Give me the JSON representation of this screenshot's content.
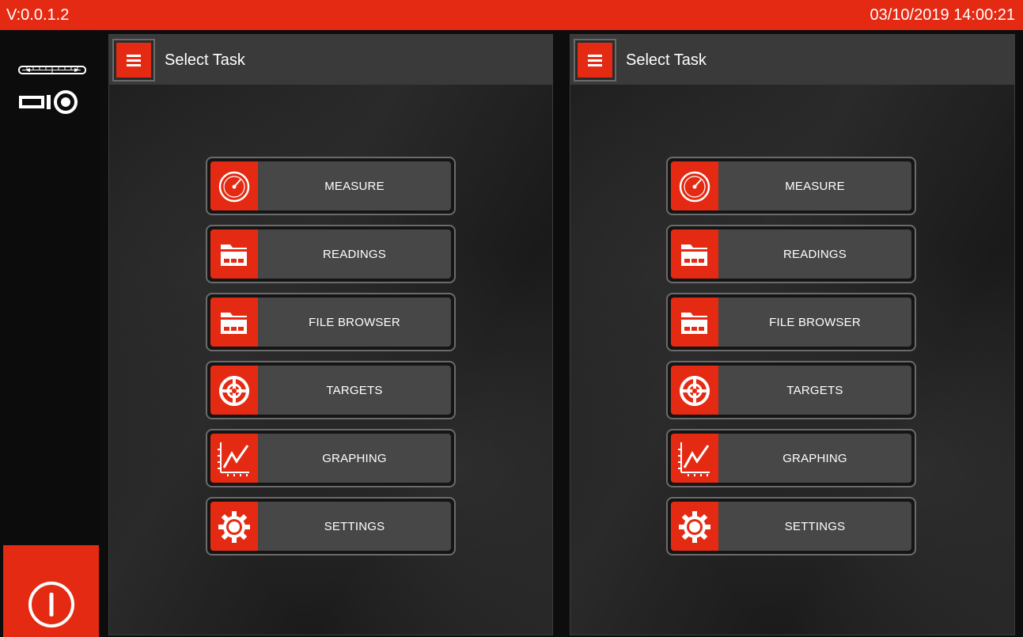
{
  "status_bar": {
    "version": "V:0.0.1.2",
    "datetime": "03/10/2019 14:00:21"
  },
  "colors": {
    "accent": "#e42a12",
    "button_face": "#474747",
    "header": "#3a3a3a"
  },
  "panels": [
    {
      "title": "Select Task",
      "menu_icon": "hamburger-menu-icon",
      "tasks": [
        {
          "label": "MEASURE",
          "icon": "gauge-icon"
        },
        {
          "label": "READINGS",
          "icon": "folder-icon"
        },
        {
          "label": "FILE BROWSER",
          "icon": "folder-icon"
        },
        {
          "label": "TARGETS",
          "icon": "target-icon"
        },
        {
          "label": "GRAPHING",
          "icon": "graph-icon"
        },
        {
          "label": "SETTINGS",
          "icon": "gear-icon"
        }
      ]
    },
    {
      "title": "Select Task",
      "menu_icon": "hamburger-menu-icon",
      "tasks": [
        {
          "label": "MEASURE",
          "icon": "gauge-icon"
        },
        {
          "label": "READINGS",
          "icon": "folder-icon"
        },
        {
          "label": "FILE BROWSER",
          "icon": "folder-icon"
        },
        {
          "label": "TARGETS",
          "icon": "target-icon"
        },
        {
          "label": "GRAPHING",
          "icon": "graph-icon"
        },
        {
          "label": "SETTINGS",
          "icon": "gear-icon"
        }
      ]
    }
  ],
  "sidebar": {
    "device_icon": "laser-device-icon",
    "power_icon": "power-icon"
  }
}
